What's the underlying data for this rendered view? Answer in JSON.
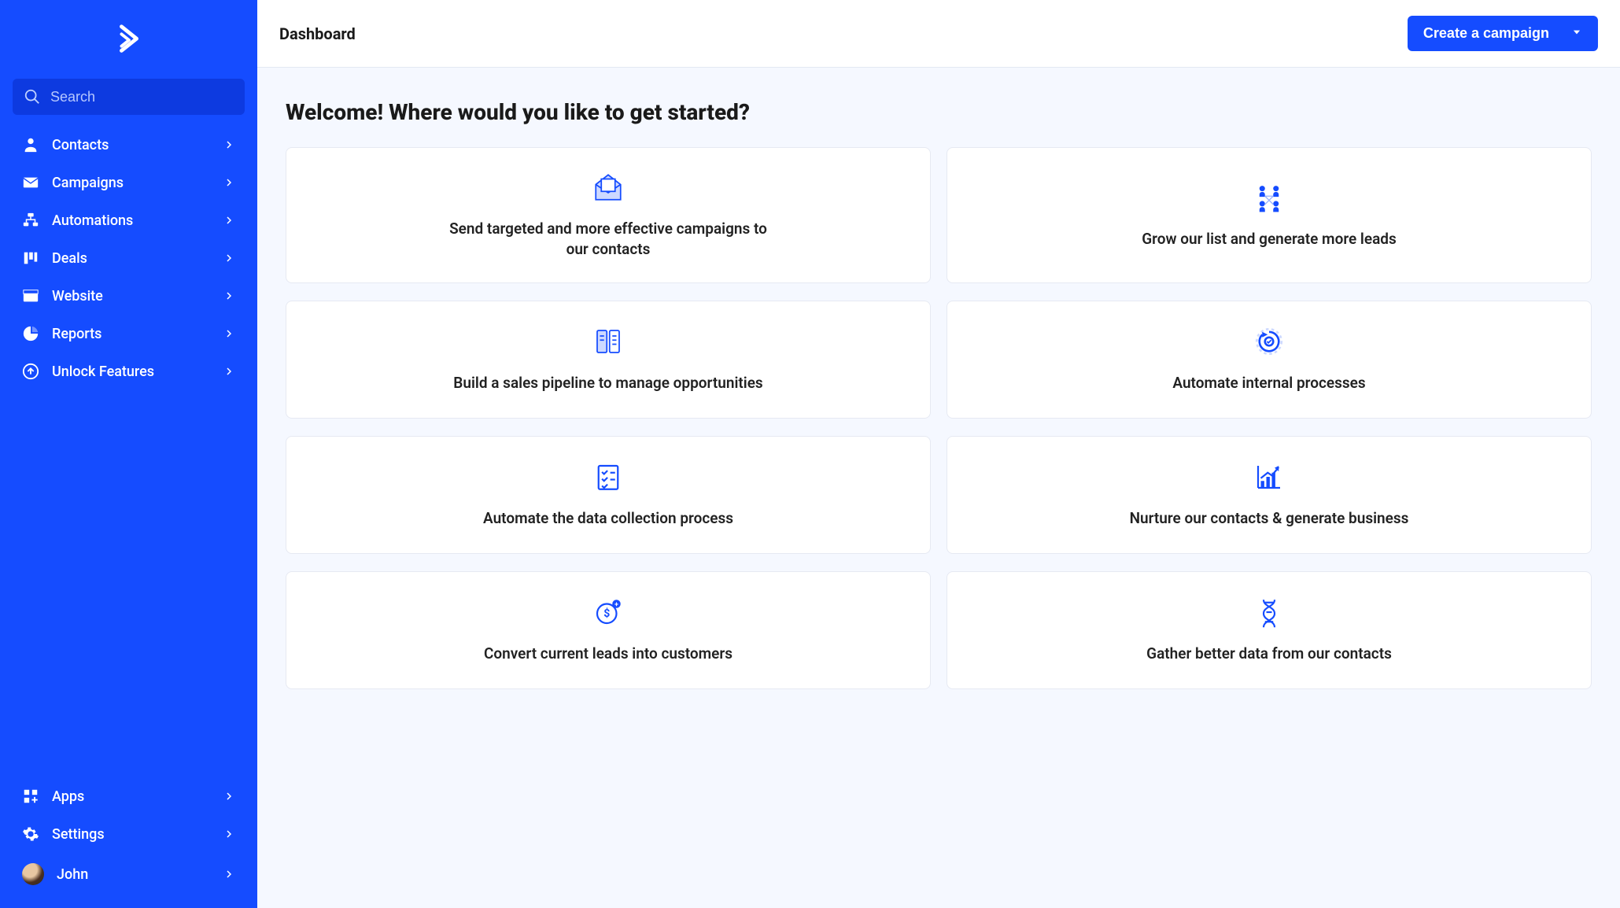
{
  "search": {
    "placeholder": "Search"
  },
  "sidebar": {
    "primary": [
      {
        "label": "Contacts",
        "icon": "person-icon"
      },
      {
        "label": "Campaigns",
        "icon": "envelope-icon"
      },
      {
        "label": "Automations",
        "icon": "flow-icon"
      },
      {
        "label": "Deals",
        "icon": "columns-icon"
      },
      {
        "label": "Website",
        "icon": "browser-icon"
      },
      {
        "label": "Reports",
        "icon": "piechart-icon"
      },
      {
        "label": "Unlock Features",
        "icon": "unlock-arrow-icon"
      }
    ],
    "secondary": [
      {
        "label": "Apps",
        "icon": "apps-icon"
      },
      {
        "label": "Settings",
        "icon": "gear-icon"
      },
      {
        "label": "John",
        "icon": "avatar"
      }
    ]
  },
  "header": {
    "title": "Dashboard",
    "cta_label": "Create a campaign"
  },
  "main": {
    "heading": "Welcome! Where would you like to get started?",
    "cards": [
      {
        "text": "Send targeted and more effective campaigns to our contacts",
        "icon": "mail-open-icon"
      },
      {
        "text": "Grow our list and generate more leads",
        "icon": "people-network-icon"
      },
      {
        "text": "Build a sales pipeline to manage opportunities",
        "icon": "pipeline-icon"
      },
      {
        "text": "Automate internal processes",
        "icon": "automation-cycle-icon"
      },
      {
        "text": "Automate the data collection process",
        "icon": "checklist-icon"
      },
      {
        "text": "Nurture our contacts & generate business",
        "icon": "growth-chart-icon"
      },
      {
        "text": "Convert current leads into customers",
        "icon": "convert-dollar-icon"
      },
      {
        "text": "Gather better data from our contacts",
        "icon": "dna-icon"
      }
    ]
  }
}
